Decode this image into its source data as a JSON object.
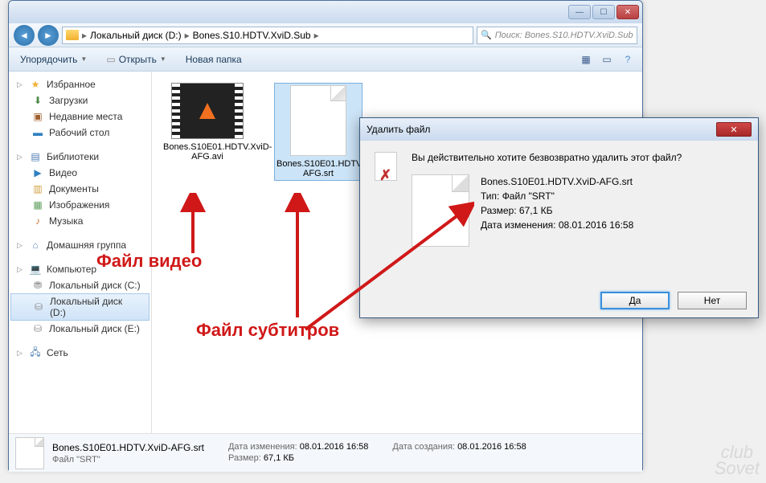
{
  "window": {
    "breadcrumb": {
      "drive": "Локальный диск (D:)",
      "folder": "Bones.S10.HDTV.XviD.Sub"
    },
    "search_placeholder": "Поиск: Bones.S10.HDTV.XviD.Sub"
  },
  "toolbar": {
    "organize": "Упорядочить",
    "open": "Открыть",
    "new_folder": "Новая папка"
  },
  "sidebar": {
    "favorites": {
      "label": "Избранное",
      "items": [
        "Загрузки",
        "Недавние места",
        "Рабочий стол"
      ]
    },
    "libraries": {
      "label": "Библиотеки",
      "items": [
        "Видео",
        "Документы",
        "Изображения",
        "Музыка"
      ]
    },
    "homegroup": {
      "label": "Домашняя группа"
    },
    "computer": {
      "label": "Компьютер",
      "items": [
        "Локальный диск (C:)",
        "Локальный диск (D:)",
        "Локальный диск (E:)"
      ],
      "selected": 1
    },
    "network": {
      "label": "Сеть"
    }
  },
  "files": [
    {
      "name": "Bones.S10E01.HDTV.XviD-AFG.avi",
      "type": "video"
    },
    {
      "name": "Bones.S10E01.HDTV.XviD-AFG.srt",
      "type": "blank"
    }
  ],
  "details": {
    "name": "Bones.S10E01.HDTV.XviD-AFG.srt",
    "type_label": "Файл \"SRT\"",
    "modified_label": "Дата изменения:",
    "modified": "08.01.2016 16:58",
    "size_label": "Размер:",
    "size": "67,1 КБ",
    "created_label": "Дата создания:",
    "created": "08.01.2016 16:58"
  },
  "dialog": {
    "title": "Удалить файл",
    "message": "Вы действительно хотите безвозвратно удалить этот файл?",
    "file_name": "Bones.S10E01.HDTV.XviD-AFG.srt",
    "type_label": "Тип:",
    "type": "Файл \"SRT\"",
    "size_label": "Размер:",
    "size": "67,1 КБ",
    "modified_label": "Дата изменения:",
    "modified": "08.01.2016 16:58",
    "yes": "Да",
    "no": "Нет"
  },
  "annotations": {
    "video_label": "Файл видео",
    "subtitle_label": "Файл субтитров"
  },
  "watermark": {
    "line1": "club",
    "line2": "Sovet"
  }
}
